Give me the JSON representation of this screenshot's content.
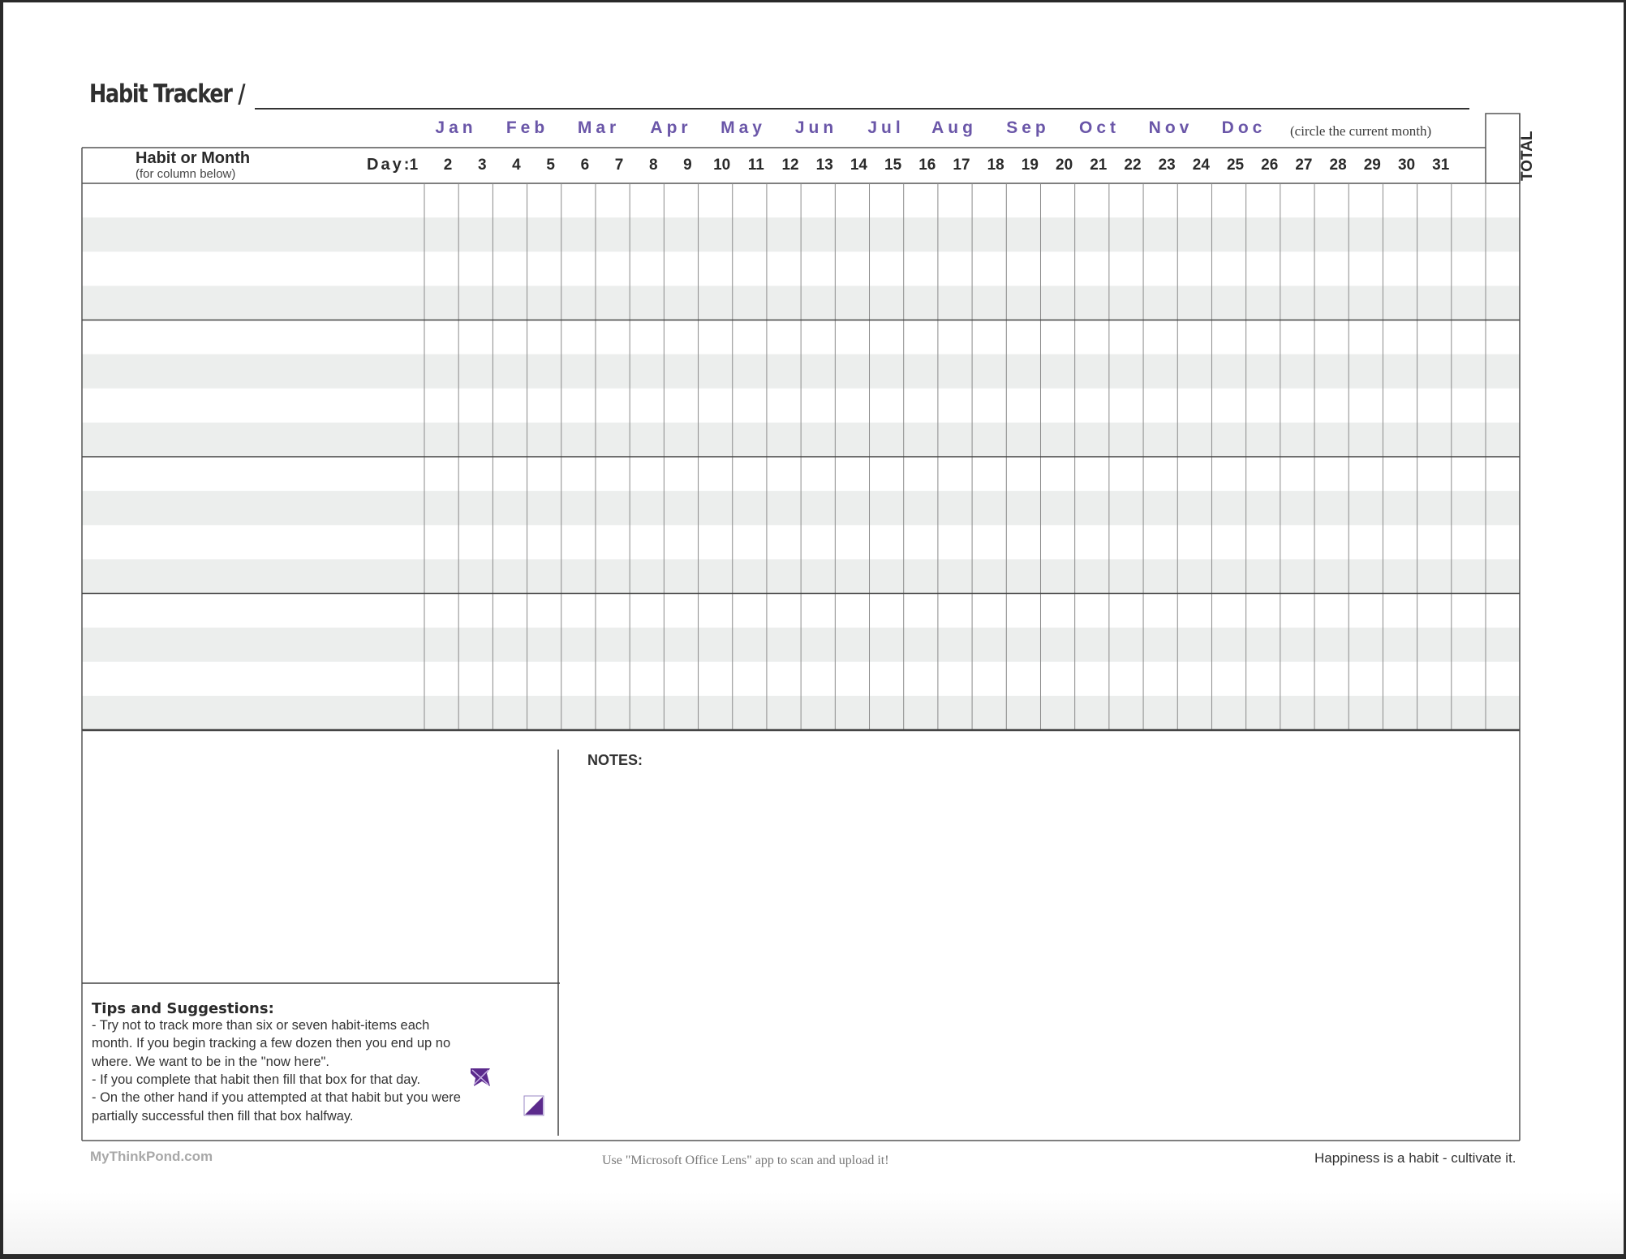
{
  "title": "Habit Tracker /",
  "months": [
    "Jan",
    "Feb",
    "Mar",
    "Apr",
    "May",
    "Jun",
    "Jul",
    "Aug",
    "Sep",
    "Oct",
    "Nov",
    "Doc"
  ],
  "month_note": "(circle the current month)",
  "header": {
    "habit_label": "Habit or Month",
    "habit_sub": "(for column below)",
    "day_label": "Day:",
    "days": [
      "1",
      "2",
      "3",
      "4",
      "5",
      "6",
      "7",
      "8",
      "9",
      "10",
      "11",
      "12",
      "13",
      "14",
      "15",
      "16",
      "17",
      "18",
      "19",
      "20",
      "21",
      "22",
      "23",
      "24",
      "25",
      "26",
      "27",
      "28",
      "29",
      "30",
      "31"
    ],
    "total_label": "TOTAL"
  },
  "habit_groups": 4,
  "rows_per_group": 4,
  "notes_label": "NOTES:",
  "tips": {
    "title": "Tips and Suggestions:",
    "lines": [
      "- Try not to track more than six or seven habit-items each",
      "month. If you begin tracking a few dozen then you end up no",
      "where. We want to be in the \"now here\".",
      "- If you complete that habit then fill that box for that day.",
      "- On the other hand if you attempted at that habit but you were",
      "partially successful then fill that box halfway."
    ],
    "accent_color": "#5b2a8c"
  },
  "footer": {
    "left": "MyThinkPond.com",
    "center": "Use \"Microsoft Office Lens\" app to scan and upload it!",
    "right": "Happiness is a habit - cultivate it."
  }
}
